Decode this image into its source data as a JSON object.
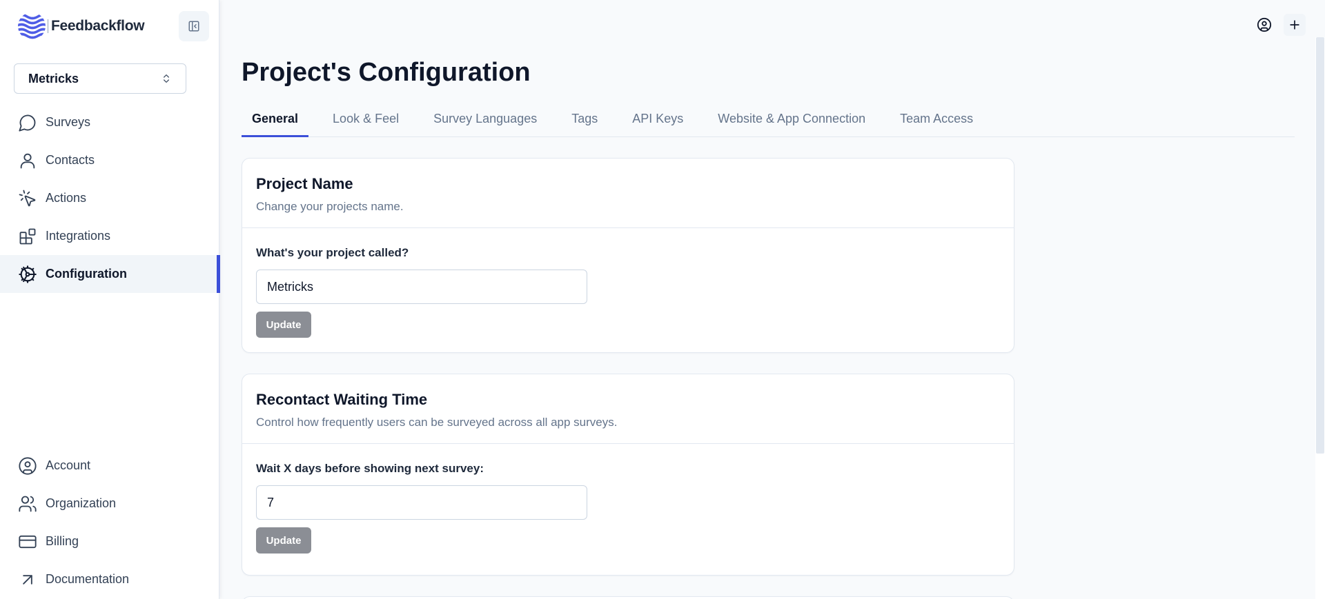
{
  "brand": {
    "name": "Feedbackflow"
  },
  "project_selector": {
    "value": "Metricks"
  },
  "nav": {
    "top": [
      {
        "label": "Surveys",
        "icon": "message-circle-icon"
      },
      {
        "label": "Contacts",
        "icon": "user-icon"
      },
      {
        "label": "Actions",
        "icon": "mouse-pointer-click-icon"
      },
      {
        "label": "Integrations",
        "icon": "blocks-icon"
      },
      {
        "label": "Configuration",
        "icon": "cog-icon",
        "active": true
      }
    ],
    "bottom": [
      {
        "label": "Account",
        "icon": "user-circle-icon"
      },
      {
        "label": "Organization",
        "icon": "users-icon"
      },
      {
        "label": "Billing",
        "icon": "credit-card-icon"
      },
      {
        "label": "Documentation",
        "icon": "arrow-up-right-icon"
      }
    ]
  },
  "page": {
    "title": "Project's Configuration"
  },
  "tabs": [
    {
      "label": "General",
      "active": true
    },
    {
      "label": "Look & Feel"
    },
    {
      "label": "Survey Languages"
    },
    {
      "label": "Tags"
    },
    {
      "label": "API Keys"
    },
    {
      "label": "Website & App Connection"
    },
    {
      "label": "Team Access"
    }
  ],
  "cards": {
    "project_name": {
      "title": "Project Name",
      "subtitle": "Change your projects name.",
      "field_label": "What's your project called?",
      "value": "Metricks",
      "button": "Update"
    },
    "recontact": {
      "title": "Recontact Waiting Time",
      "subtitle": "Control how frequently users can be surveyed across all app surveys.",
      "field_label": "Wait X days before showing next survey:",
      "value": "7",
      "button": "Update"
    }
  },
  "colors": {
    "accent": "#3b4fd9",
    "disabled_button": "#8b8e95",
    "logo": "#4f5de6"
  }
}
